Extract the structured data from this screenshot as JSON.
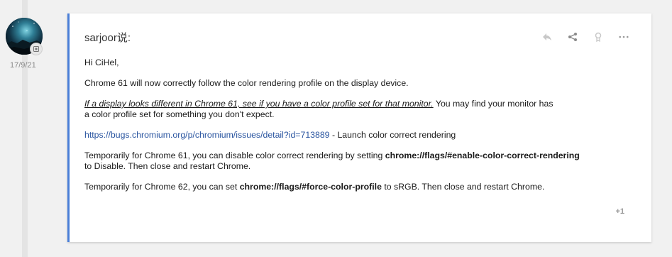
{
  "post": {
    "date": "17/9/21",
    "author": "sarjoor说:",
    "greeting": "Hi CiHel,",
    "para1": "Chrome 61 will now correctly follow the color rendering profile on the display device.",
    "para2_italic": "If a display looks different in Chrome 61, see if you have a color profile set for that monitor.",
    "para2_rest_line1": "  You may find your monitor has",
    "para2_rest_line2": "a color profile set for something you don't expect.",
    "link_url": "https://bugs.chromium.org/p/chromium/issues/detail?id=713889",
    "link_suffix": "  -  Launch color correct rendering",
    "para4_prefix": "Temporarily for Chrome 61, you can disable color correct rendering by setting ",
    "para4_flag": "chrome://flags/#enable-color-correct-rendering",
    "para4_suffix": " to Disable.  Then close and restart Chrome.",
    "para5_prefix": "Temporarily for Chrome 62, you can set ",
    "para5_flag": "chrome://flags/#force-color-profile",
    "para5_suffix": " to sRGB.  Then close and restart Chrome.",
    "plus_one": "+1"
  },
  "icons": {
    "reply": "reply-icon",
    "share": "share-icon",
    "flag": "flag-icon",
    "more": "more-icon"
  },
  "colors": {
    "accent": "#4a7fd8",
    "link": "#2a55a0"
  }
}
